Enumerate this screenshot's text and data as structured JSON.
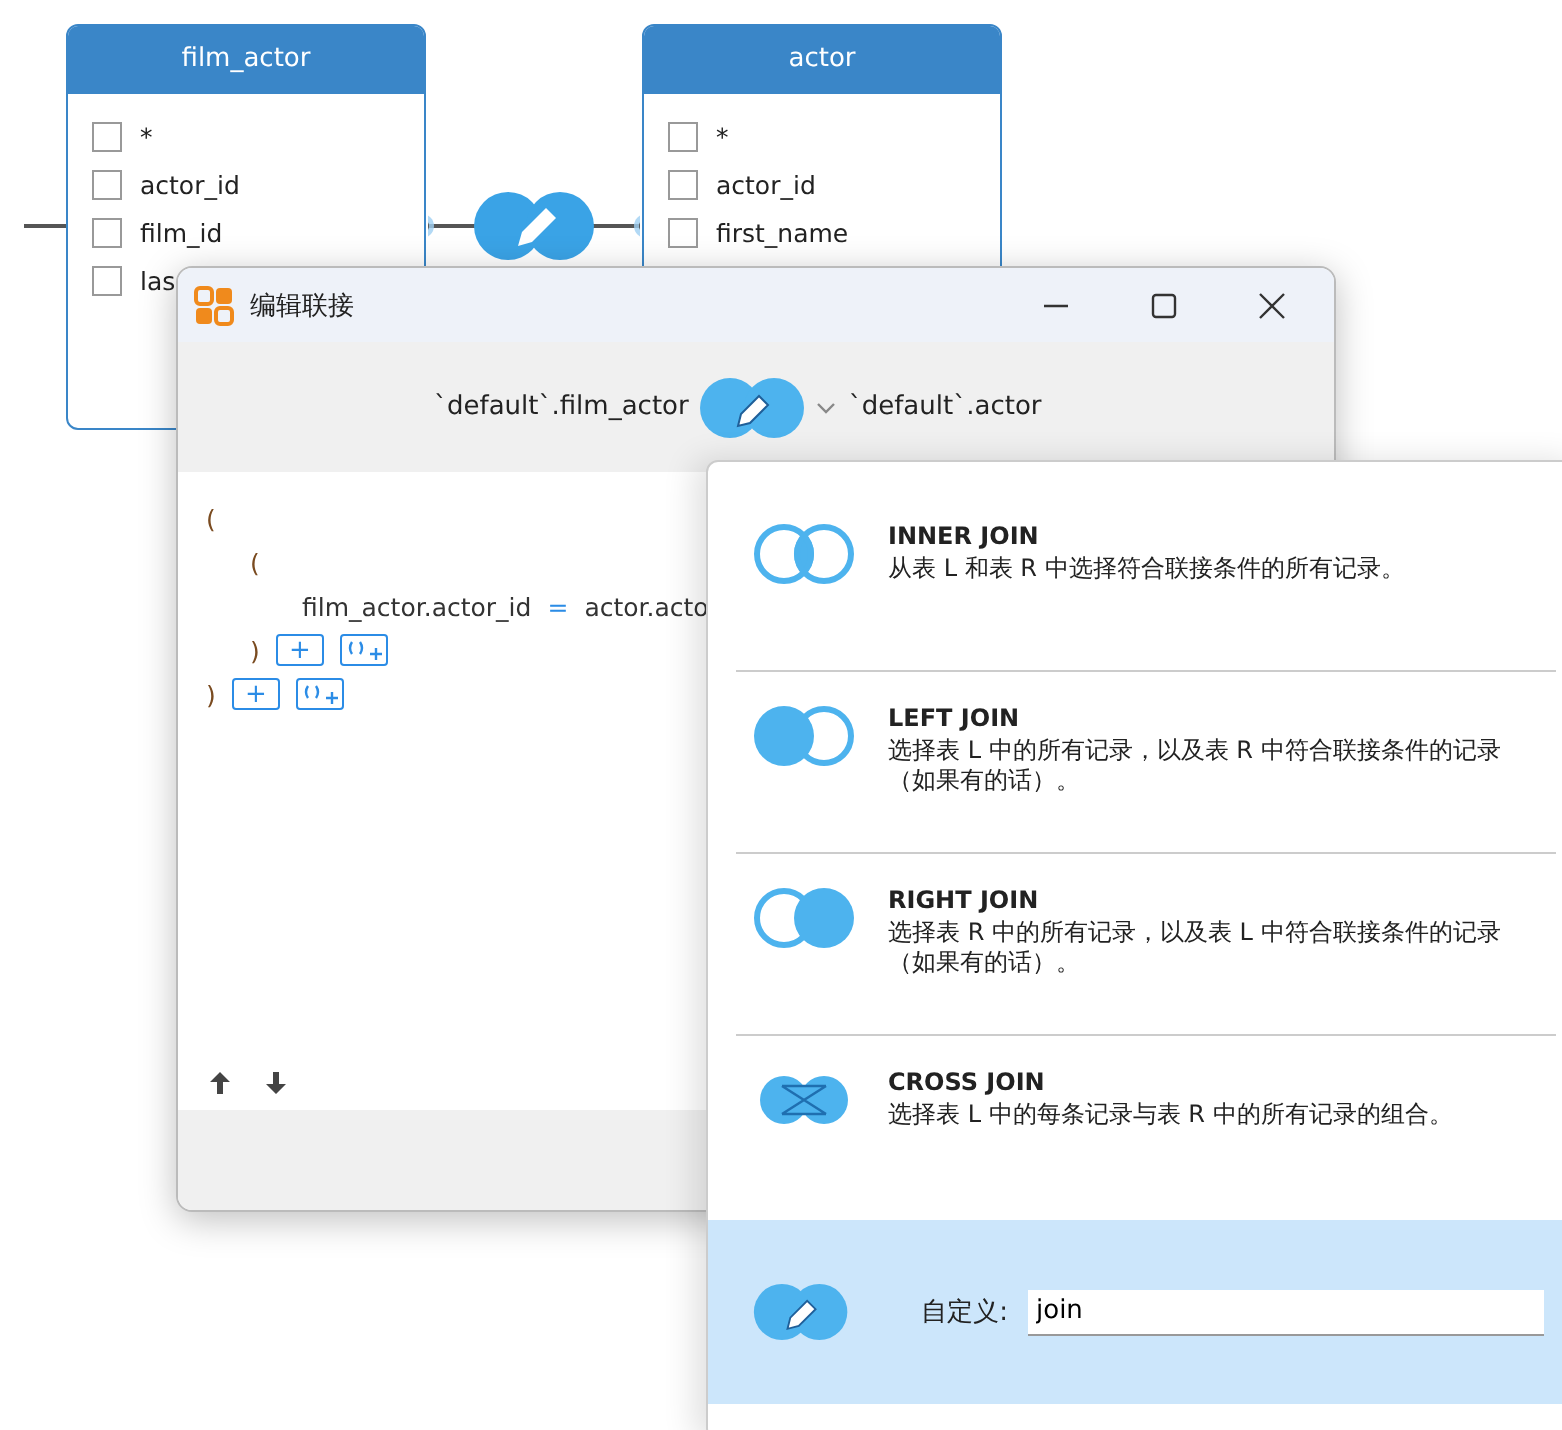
{
  "tables": [
    {
      "name": "film_actor",
      "columns": [
        {
          "name": "*",
          "checked": false
        },
        {
          "name": "actor_id",
          "checked": false
        },
        {
          "name": "film_id",
          "checked": false
        },
        {
          "name": "las",
          "checked": false
        }
      ]
    },
    {
      "name": "actor",
      "columns": [
        {
          "name": "*",
          "checked": false
        },
        {
          "name": "actor_id",
          "checked": false
        },
        {
          "name": "first_name",
          "checked": false
        }
      ]
    }
  ],
  "dialog": {
    "title": "编辑联接",
    "left_table": "`default`.film_actor",
    "right_table": "`default`.actor",
    "condition": {
      "open": "(",
      "close": ")",
      "add_button": "+",
      "group": {
        "open": "(",
        "close": ")",
        "add_button": "+",
        "left": "film_actor.actor_id",
        "operator": "=",
        "right": "actor.acto"
      }
    }
  },
  "join_menu": [
    {
      "kind": "inner",
      "title": "INNER JOIN",
      "description": "从表 L 和表 R 中选择符合联接条件的所有记录。",
      "selected": false
    },
    {
      "kind": "left",
      "title": "LEFT JOIN",
      "description": "选择表 L 中的所有记录，以及表 R 中符合联接条件的记录（如果有的话）。",
      "selected": false
    },
    {
      "kind": "right",
      "title": "RIGHT JOIN",
      "description": "选择表 R 中的所有记录，以及表 L 中符合联接条件的记录（如果有的话）。",
      "selected": false
    },
    {
      "kind": "cross",
      "title": "CROSS JOIN",
      "description": "选择表 L 中的每条记录与表 R 中的所有记录的组合。",
      "selected": false
    },
    {
      "kind": "custom",
      "label": "自定义:",
      "value": "join",
      "selected": true
    }
  ]
}
